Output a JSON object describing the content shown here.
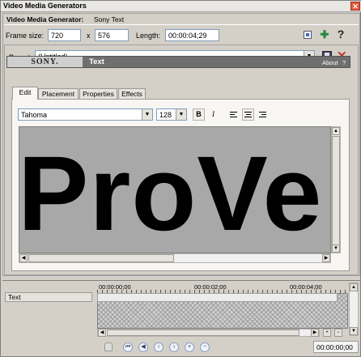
{
  "window": {
    "title": "Video Media Generators",
    "close_glyph": "✕"
  },
  "header": {
    "label": "Video Media Generator:",
    "value": "Sony Text"
  },
  "frame": {
    "size_label": "Frame size:",
    "width": "720",
    "x_sep": "x",
    "height": "576",
    "length_label": "Length:",
    "length": "00:00:04;29"
  },
  "toolbar_icons": [
    "properties-icon",
    "add-plugin-icon",
    "help-icon"
  ],
  "preset": {
    "label": "Preset:",
    "value": "(Untitled)"
  },
  "plugin_bar": {
    "brand": "SONY.",
    "name": "Text",
    "about": "About",
    "help": "?"
  },
  "tabs": [
    "Edit",
    "Placement",
    "Properties",
    "Effects"
  ],
  "editor": {
    "font": "Tahoma",
    "size": "128",
    "bold": "B",
    "italic": "I",
    "text": "ProVe"
  },
  "timeline": {
    "track": "Text",
    "marks": [
      "00:00:00;00",
      "00:00:02;00",
      "00:00:04;00"
    ],
    "position": "00:00:00;00"
  }
}
